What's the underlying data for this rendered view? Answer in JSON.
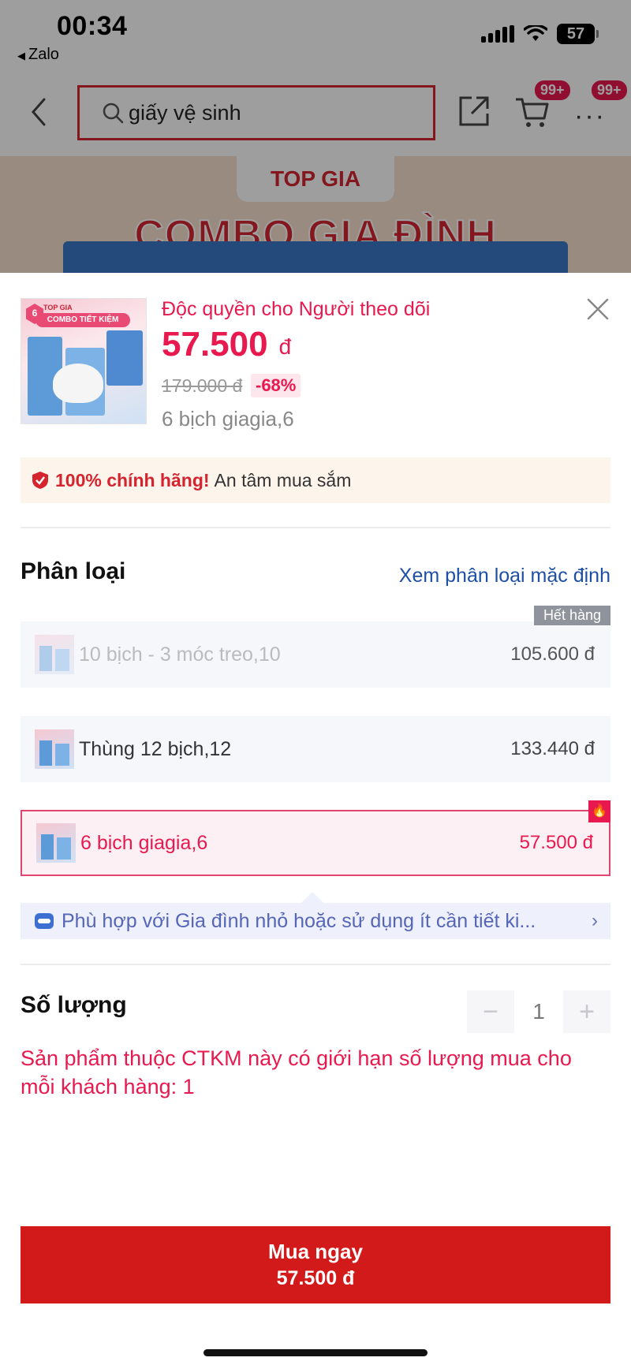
{
  "status_bar": {
    "time": "00:34",
    "back_app": "Zalo",
    "battery": "57"
  },
  "top_nav": {
    "search_query": "giấy vệ sinh",
    "cart_badge": "99+",
    "more_badge": "99+"
  },
  "banner": {
    "brand": "TOP GIA",
    "title": "COMBO GIA ĐÌNH"
  },
  "product": {
    "exclusive_label": "Độc quyền cho Người theo dõi",
    "price": "57.500",
    "currency": "đ",
    "original_price": "179.000 đ",
    "discount": "-68%",
    "selected_variant": "6 bịch giagia,6",
    "thumb_text": "COMBO TIẾT KIỆM",
    "thumb_brand": "TOP GIA",
    "thumb_badge": "6"
  },
  "authentic": {
    "highlight": "100% chính hãng!",
    "text": "An tâm mua sắm"
  },
  "variants_section": {
    "title": "Phân loại",
    "see_default": "Xem phân loại mặc định",
    "out_of_stock_label": "Hết hàng",
    "items": [
      {
        "name": "10 bịch - 3 móc treo,10",
        "price": "105.600 đ",
        "state": "out_of_stock"
      },
      {
        "name": "Thùng 12 bịch,12",
        "price": "133.440 đ",
        "state": "available"
      },
      {
        "name": "6 bịch giagia,6",
        "price": "57.500 đ",
        "state": "selected"
      }
    ],
    "suggestion": "Phù hợp với Gia đình nhỏ hoặc sử dụng ít cần tiết ki..."
  },
  "quantity": {
    "title": "Số lượng",
    "value": "1",
    "limit_note": "Sản phẩm thuộc CTKM này có giới hạn số lượng mua cho mỗi khách hàng: 1"
  },
  "buy_button": {
    "label": "Mua ngay",
    "price": "57.500 đ"
  },
  "colors": {
    "accent_pink": "#e8194e",
    "buy_red": "#d31a1a",
    "link_blue": "#1f4fa3"
  },
  "icons": [
    "back-arrow-icon",
    "search-icon",
    "share-icon",
    "cart-icon",
    "more-icon",
    "close-icon",
    "shield-check-icon",
    "fire-icon",
    "assistant-bot-icon",
    "chevron-right-icon",
    "minus-icon",
    "plus-icon"
  ]
}
